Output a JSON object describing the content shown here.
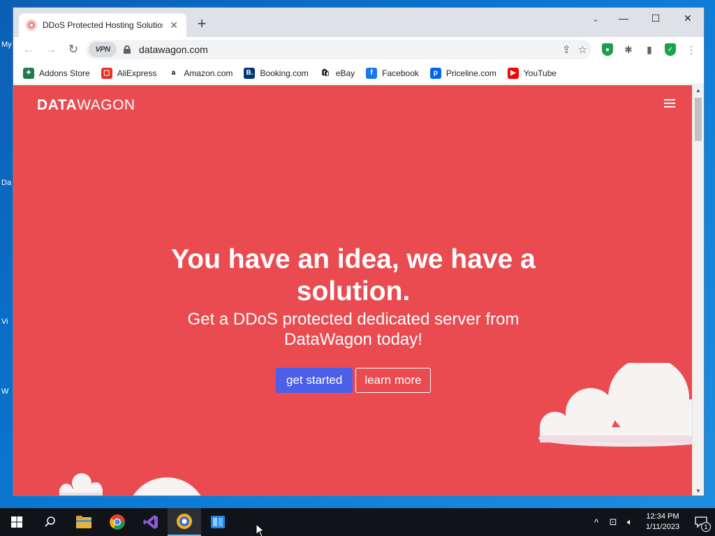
{
  "desktop": {
    "icon_labels": [
      "My",
      "Da",
      "Vi",
      "W"
    ]
  },
  "browser": {
    "tab": {
      "title": "DDoS Protected Hosting Solution",
      "close": "✕"
    },
    "new_tab": "+",
    "window_controls": {
      "tab_search": "⌄",
      "minimize": "—",
      "maximize": "☐",
      "close": "✕"
    },
    "nav": {
      "back": "←",
      "forward": "→",
      "reload": "↻"
    },
    "omnibox": {
      "vpn_label": "VPN",
      "url": "datawagon.com",
      "share": "⇪",
      "bookmark": "☆"
    },
    "extensions": {
      "puzzle": "✱",
      "sidebar": "▮",
      "menu": "⋮"
    },
    "bookmarks": [
      {
        "label": "Addons Store",
        "color": "#1e7d4a",
        "glyph": "✦"
      },
      {
        "label": "AliExpress",
        "color": "#e43225",
        "glyph": "▢"
      },
      {
        "label": "Amazon.com",
        "color": "#ffffff",
        "glyph": "a"
      },
      {
        "label": "Booking.com",
        "color": "#003580",
        "glyph": "B."
      },
      {
        "label": "eBay",
        "color": "#ffffff",
        "glyph": "🛍"
      },
      {
        "label": "Facebook",
        "color": "#1877f2",
        "glyph": "f"
      },
      {
        "label": "Priceline.com",
        "color": "#0068ef",
        "glyph": "p"
      },
      {
        "label": "YouTube",
        "color": "#ff0000",
        "glyph": "▶"
      }
    ]
  },
  "page": {
    "logo_bold": "DATA",
    "logo_light": "WAGON",
    "hero_title_line1": "You have an idea, we have a",
    "hero_title_line2": "solution.",
    "hero_sub_line1": "Get a DDoS protected dedicated server from",
    "hero_sub_line2": "DataWagon today!",
    "btn_primary": "get started",
    "btn_secondary": "learn more",
    "colors": {
      "hero_bg": "#ea4b50",
      "primary_btn": "#4b5fe9"
    }
  },
  "taskbar": {
    "time": "12:34 PM",
    "date": "1/11/2023",
    "notification_count": "1"
  }
}
